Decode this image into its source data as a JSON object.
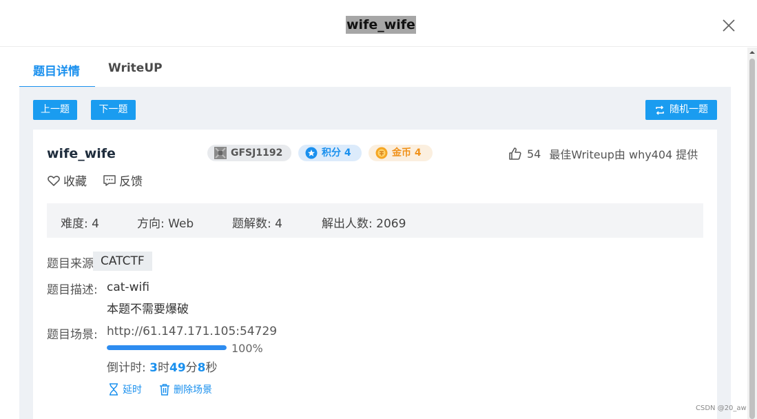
{
  "dialog": {
    "title": "wife_wife"
  },
  "tabs": [
    {
      "label": "题目详情"
    },
    {
      "label": "WriteUP"
    }
  ],
  "nav": {
    "prev": "上一题",
    "next": "下一题",
    "random": "随机一题"
  },
  "question": {
    "title": "wife_wife",
    "code": "GFSJ1192",
    "score": "积分 4",
    "gold": "金币 4",
    "likes": "54",
    "best_writeup": "最佳Writeup由 why404 提供",
    "favorite": "收藏",
    "feedback": "反馈"
  },
  "stats": {
    "difficulty": "难度: 4",
    "direction": "方向: Web",
    "solves": "题解数: 4",
    "solvers": "解出人数: 2069"
  },
  "details": {
    "source_label": "题目来源:",
    "source_value": "CATCTF",
    "desc_label": "题目描述:",
    "desc_line1": "cat-wifi",
    "desc_line2": "本题不需要爆破",
    "scene_label": "题目场景:",
    "scene_url": "http://61.147.171.105:54729",
    "progress": 100,
    "progress_text": "100%",
    "countdown_label": "倒计时:",
    "hours": "3",
    "hours_unit": "时",
    "minutes": "49",
    "minutes_unit": "分",
    "seconds": "8",
    "seconds_unit": "秒",
    "extend_label": "延时",
    "delete_label": "删除场景"
  },
  "watermark": "CSDN @20_aw",
  "colors": {
    "accent": "#1a90ee",
    "button": "#1a9cf0",
    "gold": "#f0921b"
  }
}
